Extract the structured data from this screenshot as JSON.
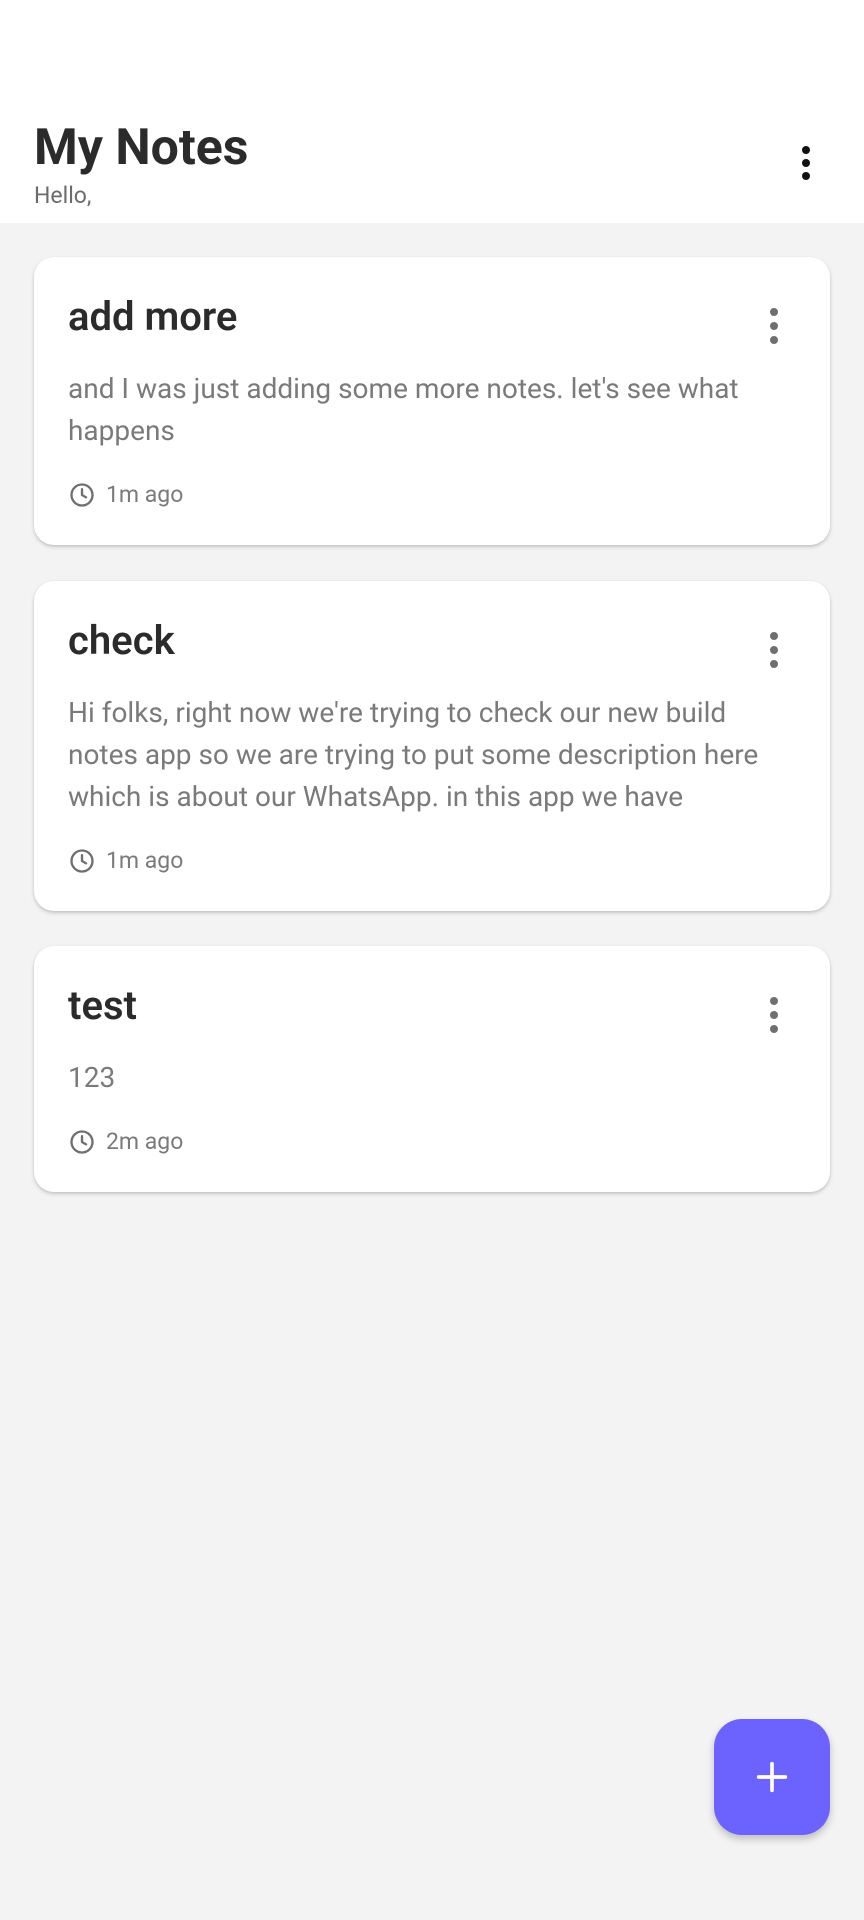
{
  "header": {
    "title": "My Notes",
    "subtitle": "Hello,"
  },
  "notes": [
    {
      "title": "add more",
      "body": "and I was just adding some more notes. let's see what happens",
      "time": "1m ago"
    },
    {
      "title": "check",
      "body": "Hi folks, right now we're trying to check our new build notes app so we are trying to put some description here which is about our WhatsApp. in this app we have",
      "time": "1m ago"
    },
    {
      "title": "test",
      "body": "123",
      "time": "2m ago"
    }
  ],
  "icons": {
    "header_menu": "more-vertical-icon",
    "card_menu": "more-vertical-icon",
    "time": "clock-icon",
    "fab": "plus-icon"
  },
  "colors": {
    "accent": "#6c63ff",
    "background": "#f3f3f3",
    "card": "#ffffff"
  }
}
